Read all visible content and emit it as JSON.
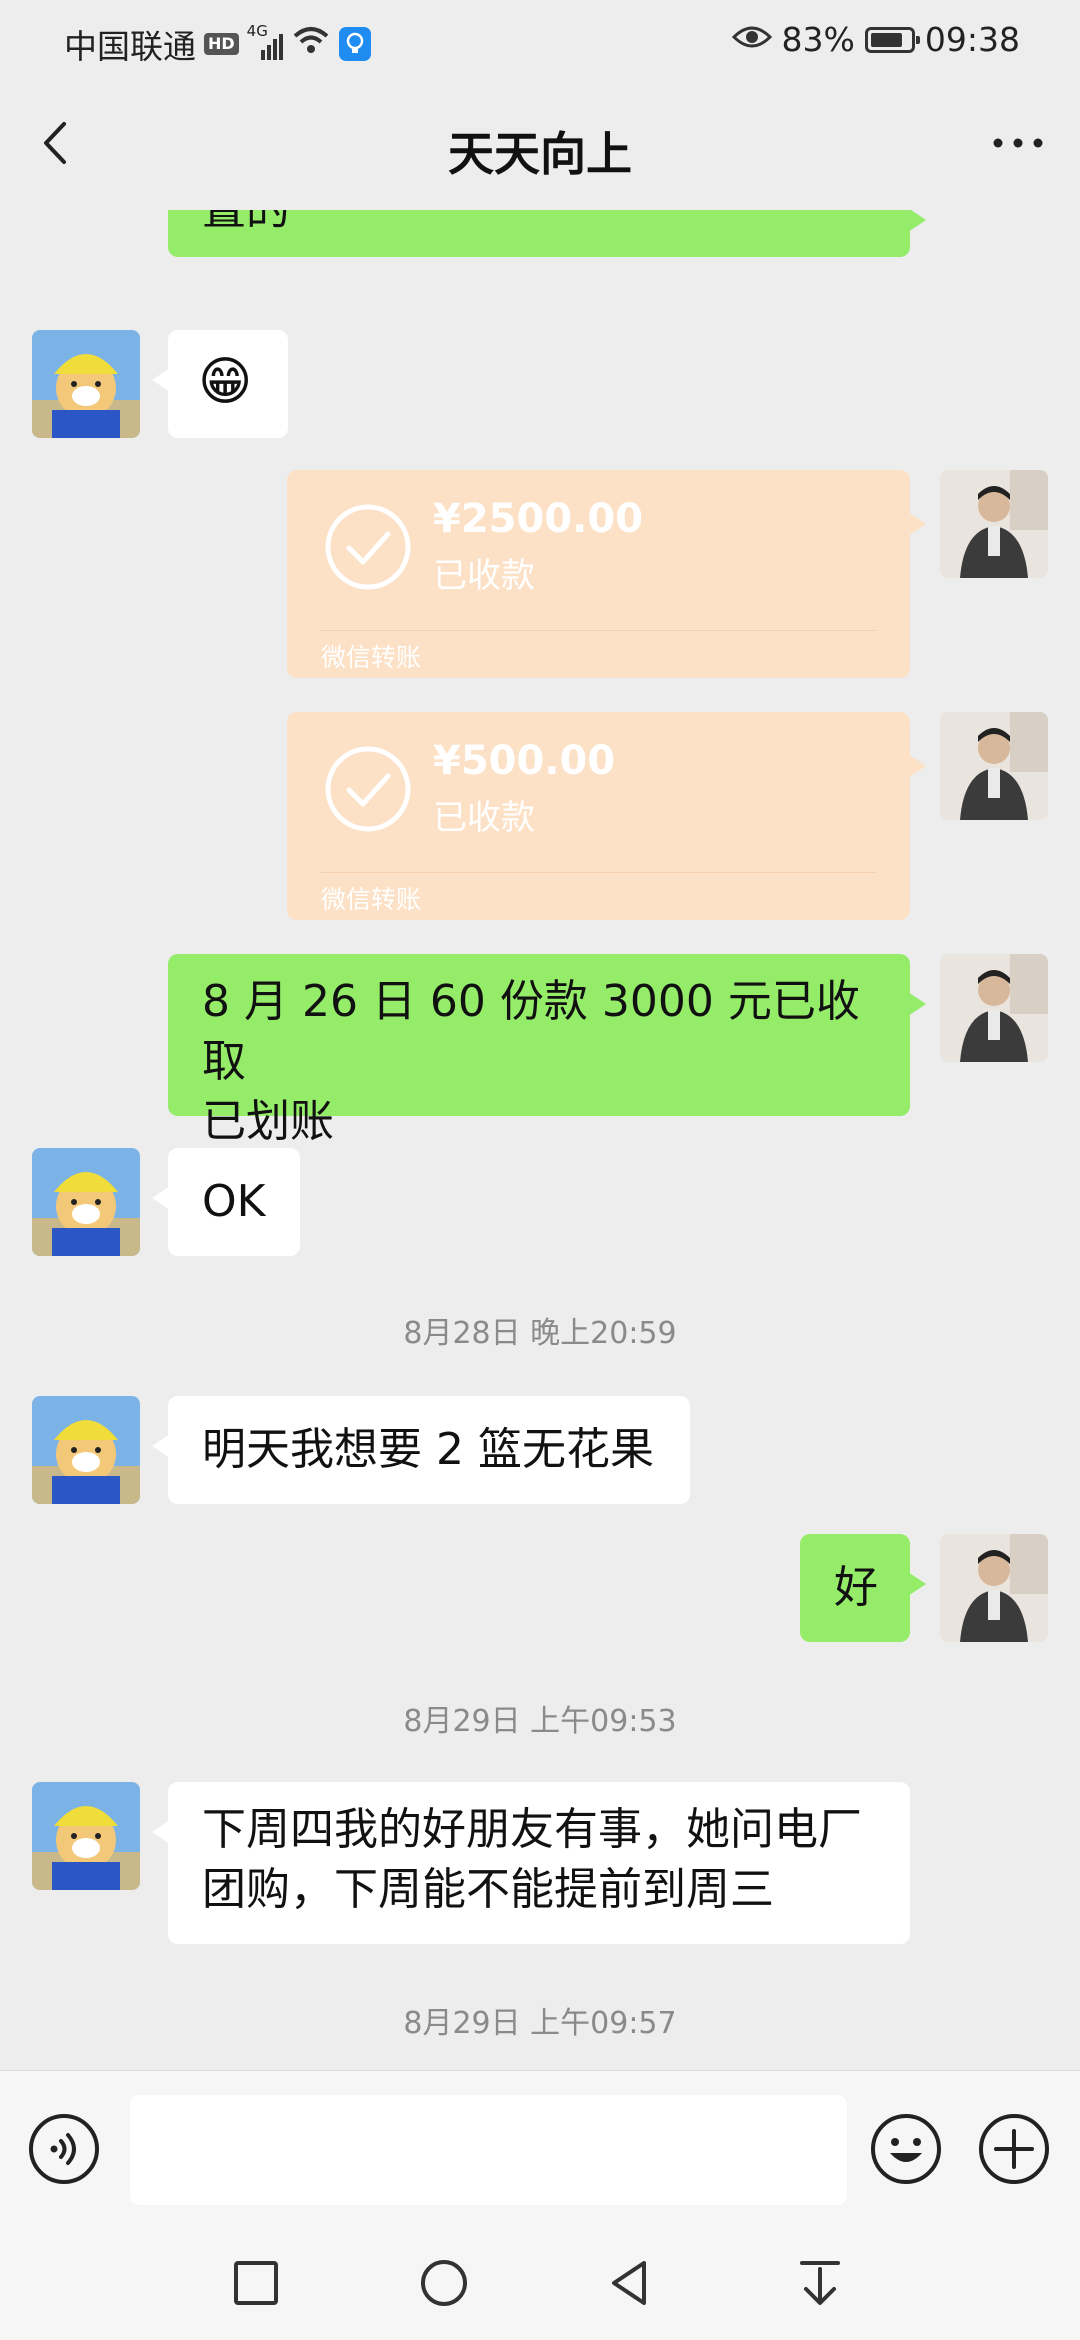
{
  "status_bar": {
    "carrier": "中国联通",
    "hd": "HD",
    "network": "4G",
    "battery_percent": "83%",
    "battery_level": 0.83,
    "time": "09:38",
    "icons": [
      "hd-icon",
      "signal-icon",
      "wifi-icon",
      "bulb-icon",
      "eye-icon",
      "battery-icon"
    ]
  },
  "header": {
    "title": "天天向上"
  },
  "messages": [
    {
      "type": "text",
      "side": "right",
      "text": "置的"
    },
    {
      "type": "emoji",
      "side": "left",
      "emoji": "😁"
    },
    {
      "type": "transfer",
      "side": "right",
      "amount": "¥2500.00",
      "status": "已收款",
      "kind": "微信转账"
    },
    {
      "type": "transfer",
      "side": "right",
      "amount": "¥500.00",
      "status": "已收款",
      "kind": "微信转账"
    },
    {
      "type": "text",
      "side": "right",
      "text_line1": "8 月 26 日 60 份款 3000 元已收取",
      "text_line2": "已划账"
    },
    {
      "type": "text",
      "side": "left",
      "text": "OK"
    },
    {
      "type": "time",
      "text": "8月28日 晚上20:59"
    },
    {
      "type": "text",
      "side": "left",
      "text": "明天我想要 2 篮无花果"
    },
    {
      "type": "text",
      "side": "right",
      "text": "好"
    },
    {
      "type": "time",
      "text": "8月29日 上午09:53"
    },
    {
      "type": "text",
      "side": "left",
      "text_line1": "下周四我的好朋友有事，她问电厂",
      "text_line2": "团购，下周能不能提前到周三"
    },
    {
      "type": "time",
      "text": "8月29日 上午09:57"
    }
  ],
  "input_bar": {
    "voice_icon": "voice-icon",
    "emoji_icon": "emoji-icon",
    "plus_icon": "plus-icon",
    "value": ""
  },
  "colors": {
    "sent_bubble": "#95ec69",
    "received_bubble": "#ffffff",
    "transfer_bubble": "#fce1c6",
    "background": "#ededed"
  }
}
